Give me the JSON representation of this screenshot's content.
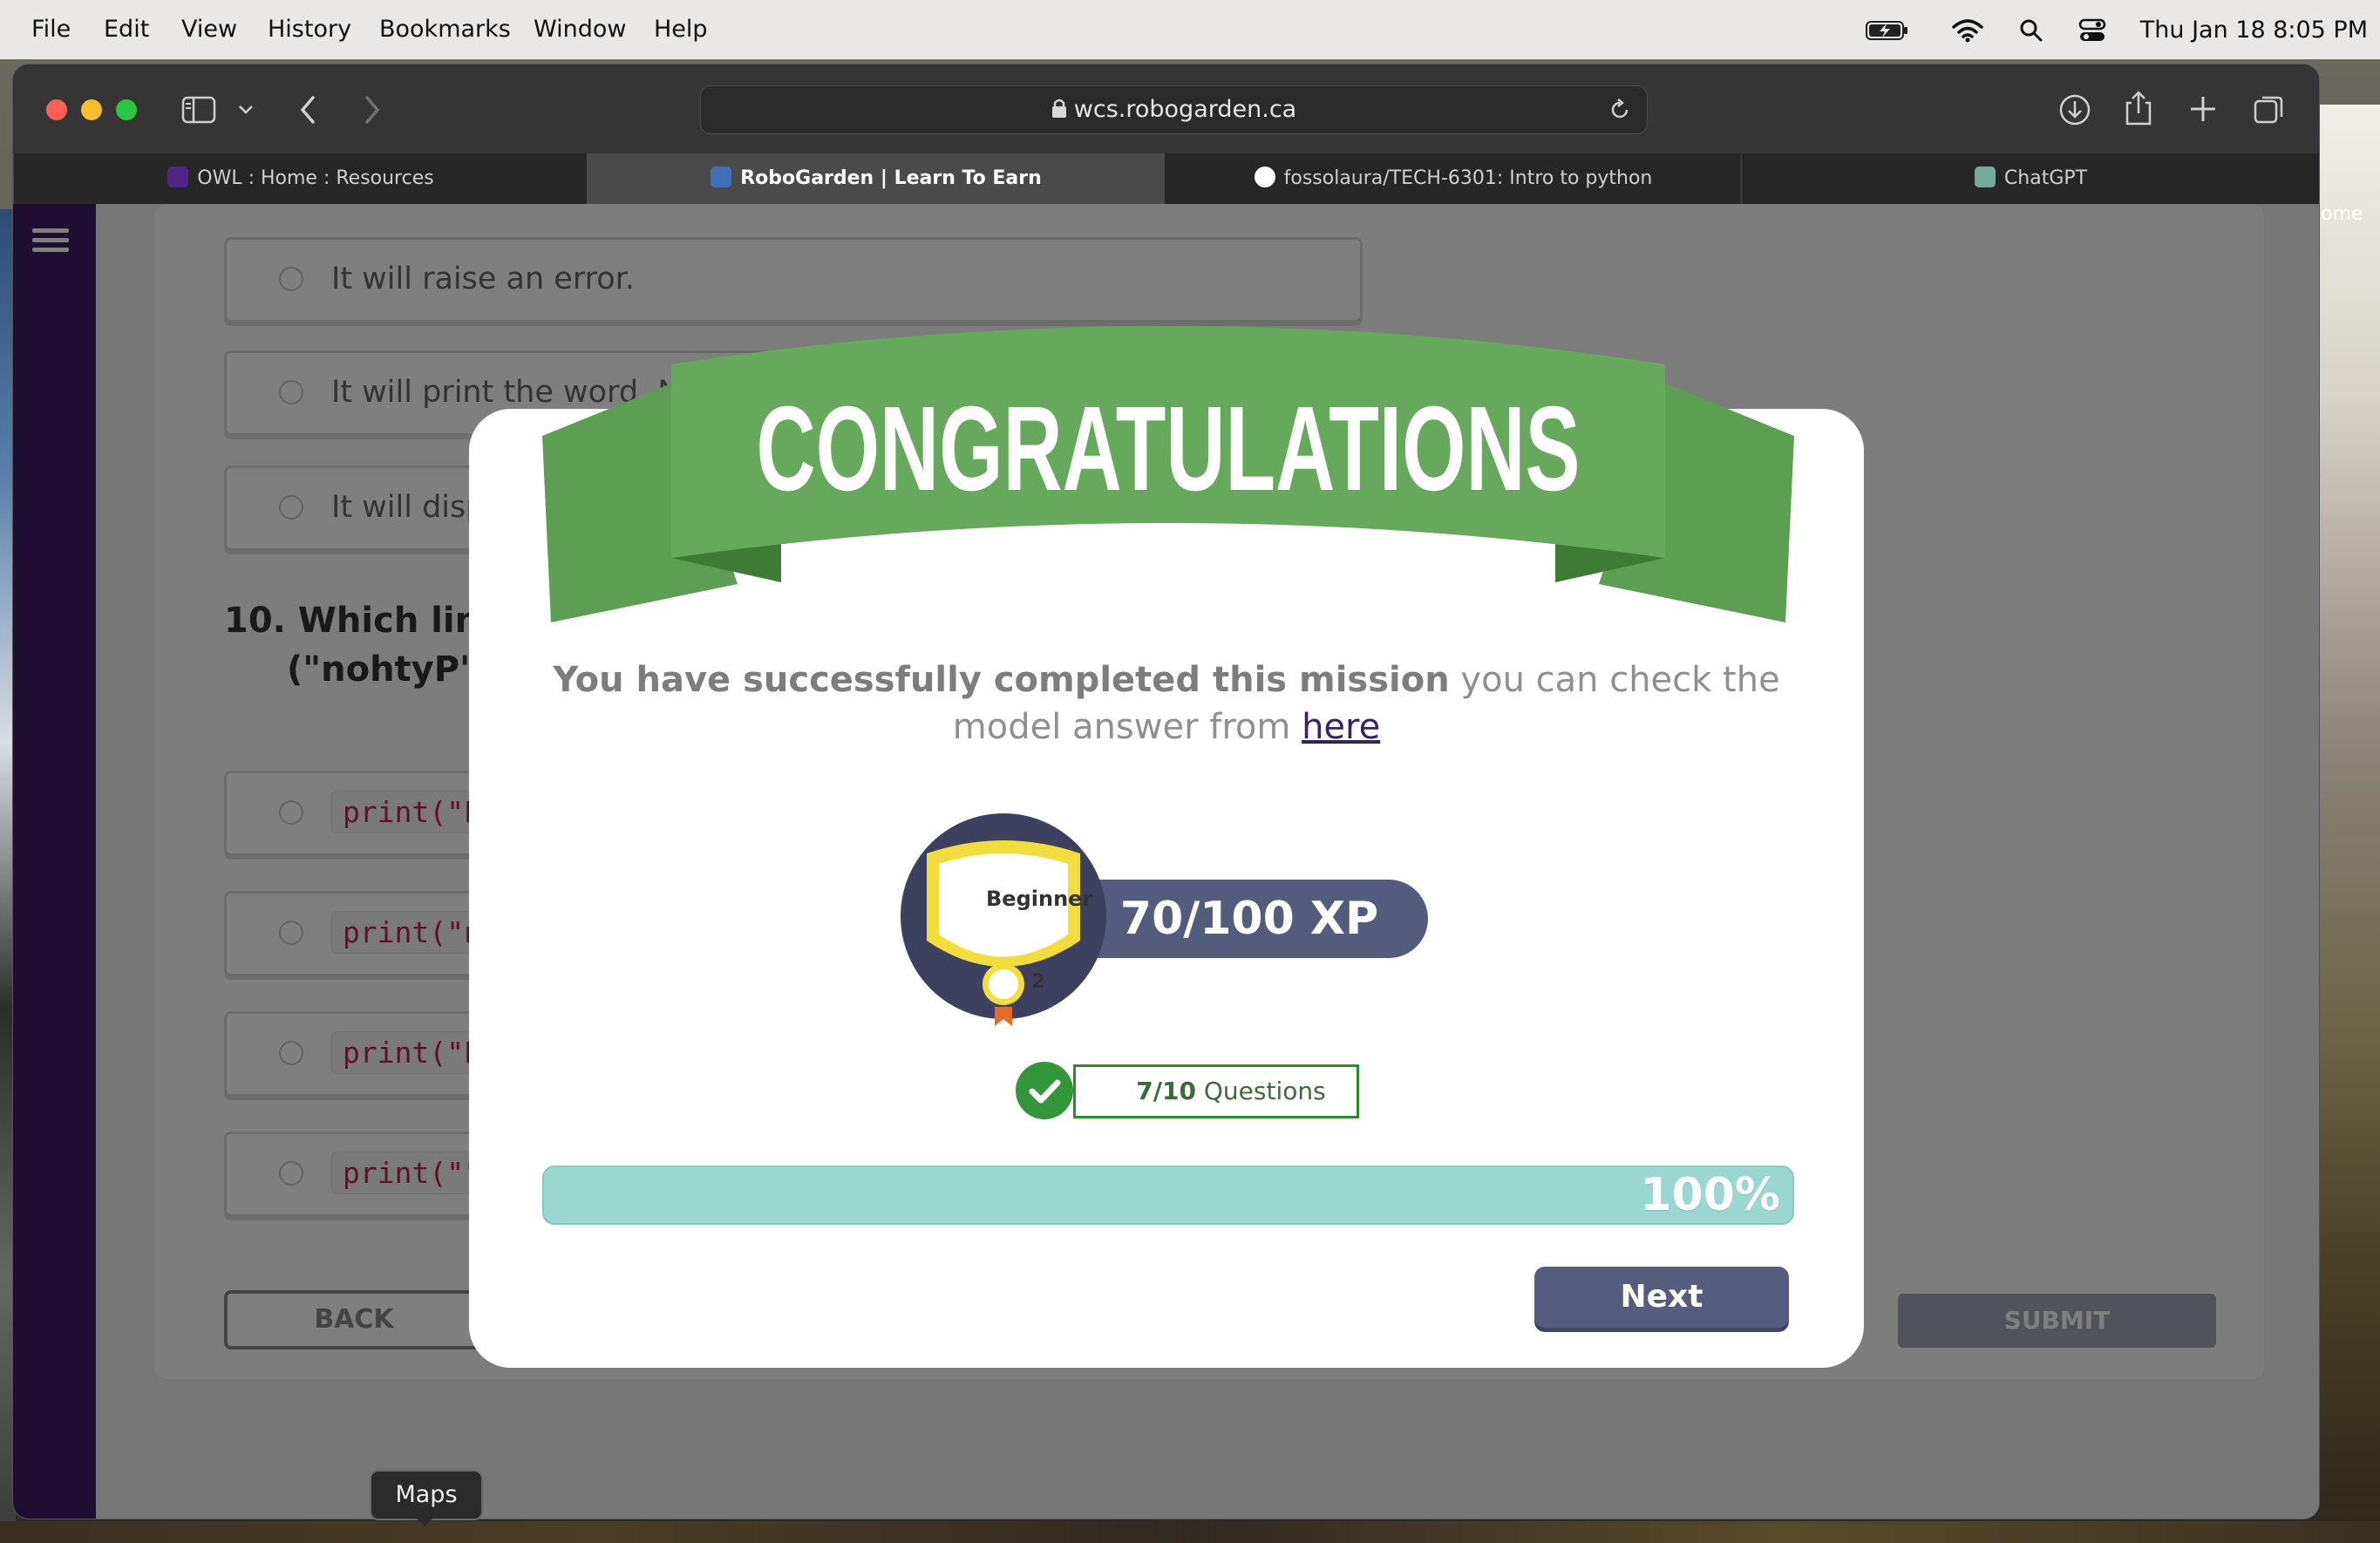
{
  "menubar": {
    "items": [
      "File",
      "Edit",
      "View",
      "History",
      "Bookmarks",
      "Window",
      "Help"
    ],
    "clock": "Thu Jan 18  8:05 PM"
  },
  "browser": {
    "url": "wcs.robogarden.ca",
    "tabs": [
      {
        "label": "OWL : Home : Resources",
        "icon_color": "#4f2683"
      },
      {
        "label": "RoboGarden | Learn To Earn",
        "icon_color": "#3f6fb5"
      },
      {
        "label": "fossolaura/TECH-6301: Intro to python",
        "icon_color": "#ffffff"
      },
      {
        "label": "ChatGPT",
        "icon_color": "#74aa9c"
      }
    ],
    "active_tab": 1
  },
  "desktop": {
    "edge_label": "ome"
  },
  "quiz": {
    "options_prev": [
      "It will raise an error.",
      "It will print the word, No",
      "It will disp"
    ],
    "question_number": "10.",
    "question_line1": "Which line",
    "question_line2": "(\"nohtyP\")",
    "code_options": [
      "print(\"P",
      "print(\"n",
      "print(\"P",
      "print(\"\""
    ],
    "back_label": "BACK",
    "submit_label": "SUBMIT"
  },
  "modal": {
    "banner_text": "CONGRATULATIONS",
    "message_bold": "You have successfully completed this mission",
    "message_rest": " you can check the model answer from ",
    "link_text": "here",
    "badge_level": "Beginner",
    "badge_number": "2",
    "xp_text": "70/100 XP",
    "questions_bold": "7/10",
    "questions_rest": " Questions",
    "progress_percent": 100,
    "progress_label": "100%",
    "next_label": "Next",
    "colors": {
      "banner": "#67a95c",
      "accent": "#565c7d",
      "progress": "#9ad7d0",
      "check": "#33963a"
    }
  },
  "dock_tooltip": "Maps"
}
